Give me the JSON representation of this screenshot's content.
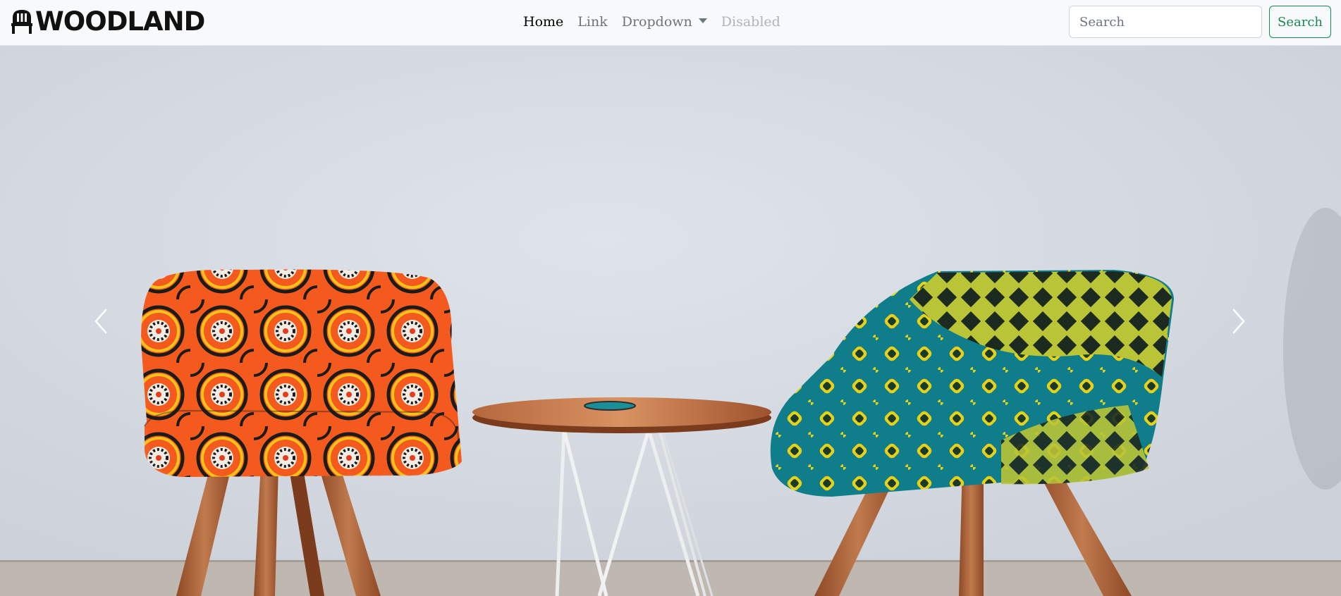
{
  "navbar": {
    "brand": "WOODLAND",
    "links": [
      {
        "label": "Home",
        "state": "active"
      },
      {
        "label": "Link",
        "state": "normal"
      },
      {
        "label": "Dropdown",
        "state": "dropdown"
      },
      {
        "label": "Disabled",
        "state": "disabled"
      }
    ],
    "search": {
      "placeholder": "Search",
      "button_label": "Search"
    }
  },
  "carousel": {
    "slide_image": "two-patterned-armchairs-with-wooden-side-table",
    "prev_icon": "chevron-left-icon",
    "next_icon": "chevron-right-icon"
  },
  "colors": {
    "navbar_bg": "#f8f9fa",
    "search_button": "#198754",
    "wall": "#d5d9e1",
    "orange_chair": "#f2581e",
    "teal_chair": "#0f7e8a",
    "wood": "#a9623a"
  }
}
